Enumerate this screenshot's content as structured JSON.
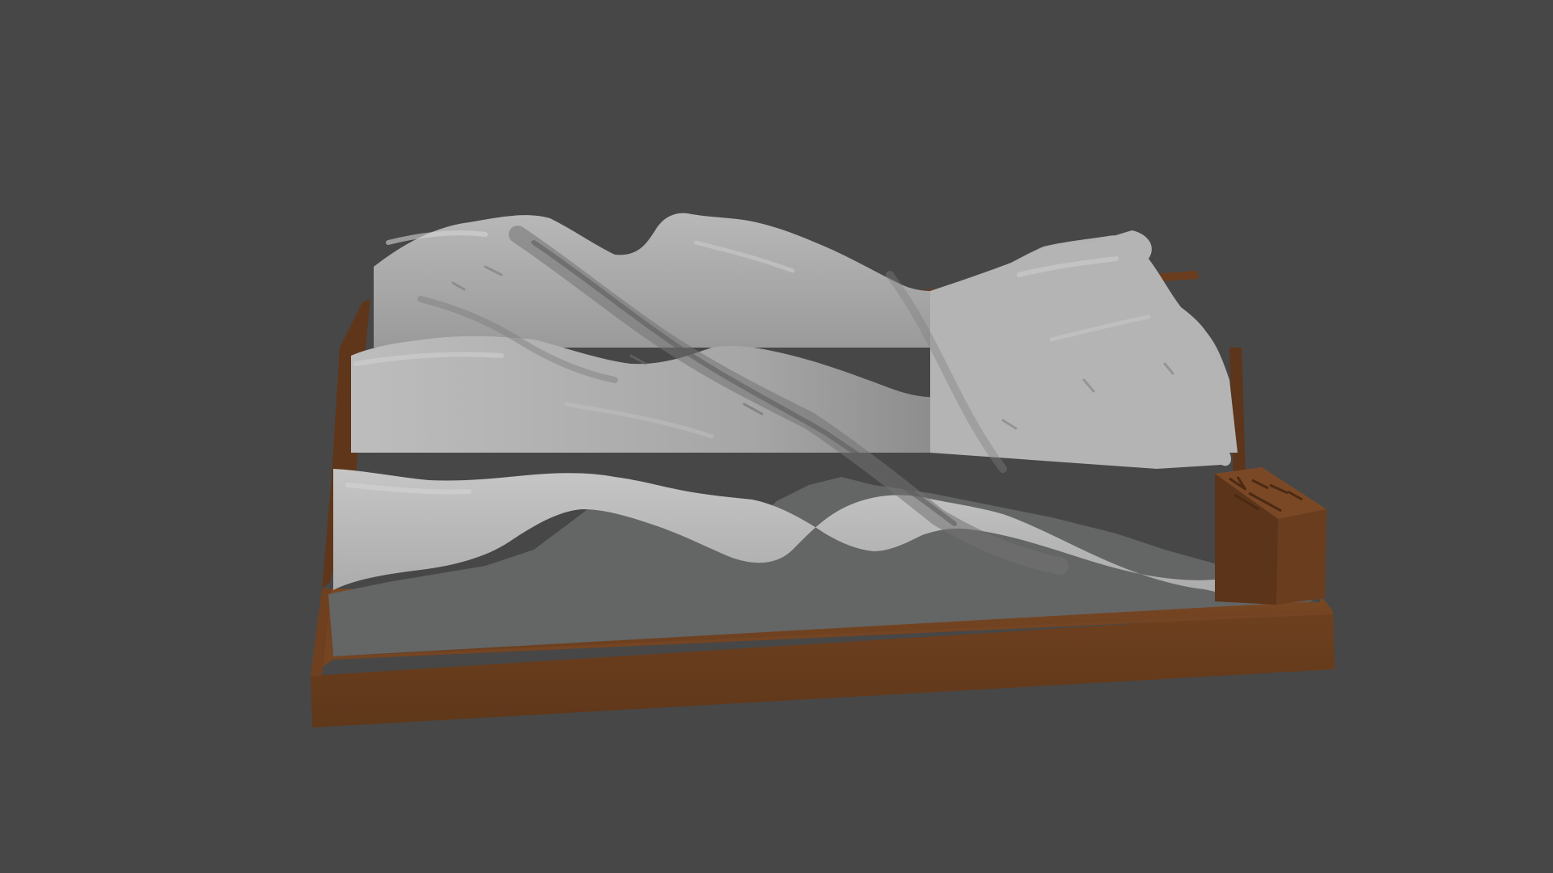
{
  "scene": {
    "description_label": "",
    "colors": {
      "background": "#474747",
      "terrain_light": "#c9c9c9",
      "terrain_mid": "#a9a9a9",
      "terrain_shadow": "#6f6f6f",
      "cut_face": "#646565",
      "base_frame": "#6b3f1e",
      "base_frame_shadow": "#55311a",
      "base_frame_light": "#7a4824"
    },
    "objects": [
      {
        "name": "terrain-mesh",
        "material": "gray-clay"
      },
      {
        "name": "base-frame",
        "material": "brown"
      },
      {
        "name": "legend-block",
        "material": "brown"
      }
    ]
  }
}
